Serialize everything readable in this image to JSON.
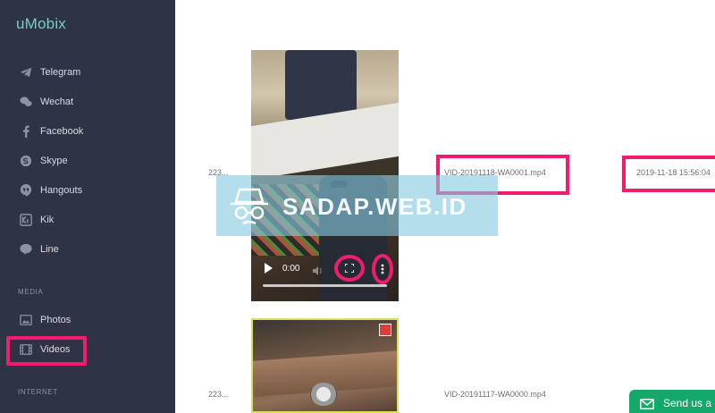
{
  "app": {
    "logo": "uMobix"
  },
  "sidebar": {
    "items": [
      {
        "label": "Telegram",
        "icon": "telegram-icon"
      },
      {
        "label": "Wechat",
        "icon": "wechat-icon"
      },
      {
        "label": "Facebook",
        "icon": "facebook-icon"
      },
      {
        "label": "Skype",
        "icon": "skype-icon"
      },
      {
        "label": "Hangouts",
        "icon": "hangouts-icon"
      },
      {
        "label": "Kik",
        "icon": "kik-icon"
      },
      {
        "label": "Line",
        "icon": "line-icon"
      }
    ],
    "sections": {
      "media": "MEDIA",
      "internet": "INTERNET"
    },
    "media_items": [
      {
        "label": "Photos",
        "icon": "photos-icon"
      },
      {
        "label": "Videos",
        "icon": "videos-icon",
        "active": true
      }
    ]
  },
  "videos": [
    {
      "id": "223...",
      "filename": "VID-20191118-WA0001.mp4",
      "date": "2019-11-18 15:56:04",
      "player_time": "0:00",
      "progress": 0
    },
    {
      "id": "223...",
      "filename": "VID-20191117-WA0000.mp4",
      "date": ""
    }
  ],
  "watermark": {
    "text": "SADAP.WEB.ID"
  },
  "support": {
    "send_label": "Send us a"
  },
  "colors": {
    "sidebar_bg": "#2e3345",
    "highlight": "#ee1d6e",
    "accent_logo": "#6fd2c2",
    "send_bg": "#14a86a"
  }
}
